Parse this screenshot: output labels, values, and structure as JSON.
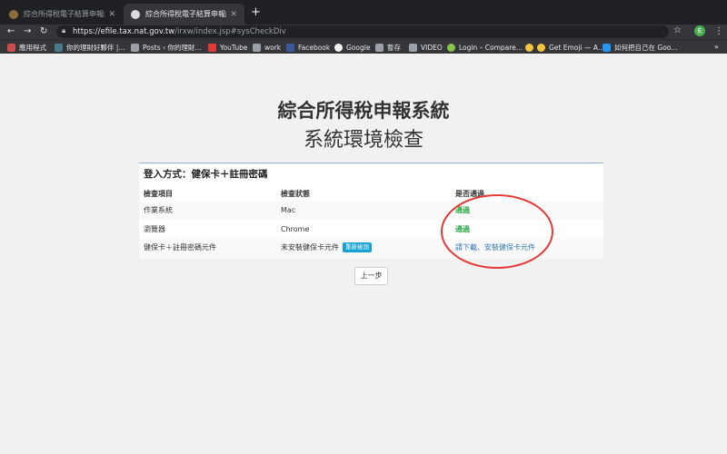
{
  "browser": {
    "tabs": [
      {
        "title": "綜合所得稅電子結算申報繳稅-系",
        "active": false
      },
      {
        "title": "綜合所得稅電子結算申報繳稅系",
        "active": true
      }
    ],
    "new_tab": "+",
    "url_host": "https://efile.tax.nat.gov.tw",
    "url_path": "/irxw/index.jsp#sysCheckDiv",
    "profile_initial": "E",
    "bookmarks": [
      {
        "label": "應用程式",
        "icon": "apps-grid-icon"
      },
      {
        "label": "你的理財好夥伴 |...",
        "icon": "site-icon"
      },
      {
        "label": "Posts ‹ 你的理財...",
        "icon": "blog-icon"
      },
      {
        "label": "YouTube",
        "icon": "youtube-icon"
      },
      {
        "label": "work",
        "icon": "folder-icon"
      },
      {
        "label": "Facebook",
        "icon": "facebook-icon"
      },
      {
        "label": "Google",
        "icon": "google-icon"
      },
      {
        "label": "暫存",
        "icon": "folder-icon"
      },
      {
        "label": "VIDEO",
        "icon": "folder-icon"
      },
      {
        "label": "Login – Compare...",
        "icon": "site-icon"
      },
      {
        "label": "Get Emoji — A...",
        "icon": "emoji-icon"
      },
      {
        "label": "如何把自己在 Goo...",
        "icon": "bookmark-icon"
      }
    ]
  },
  "page": {
    "title": "綜合所得稅申報系統",
    "subtitle": "系統環境檢查"
  },
  "check": {
    "heading": "登入方式：健保卡＋註冊密碼",
    "columns": [
      "檢查項目",
      "檢查狀態",
      "是否通過"
    ],
    "rows": [
      {
        "item": "作業系統",
        "status": "Mac",
        "result": "通過"
      },
      {
        "item": "瀏覽器",
        "status": "Chrome",
        "result": "通過"
      },
      {
        "item": "健保卡＋註冊密碼元件",
        "status": "未安裝健保卡元件",
        "status_button": "重新檢測",
        "result": "請下載、安裝健保卡元件"
      }
    ]
  },
  "actions": {
    "back": "上一步"
  },
  "colors": {
    "pass": "#2aa744",
    "link": "#337ab7",
    "redetect": "#17a2d6",
    "annotation": "#e53935"
  }
}
